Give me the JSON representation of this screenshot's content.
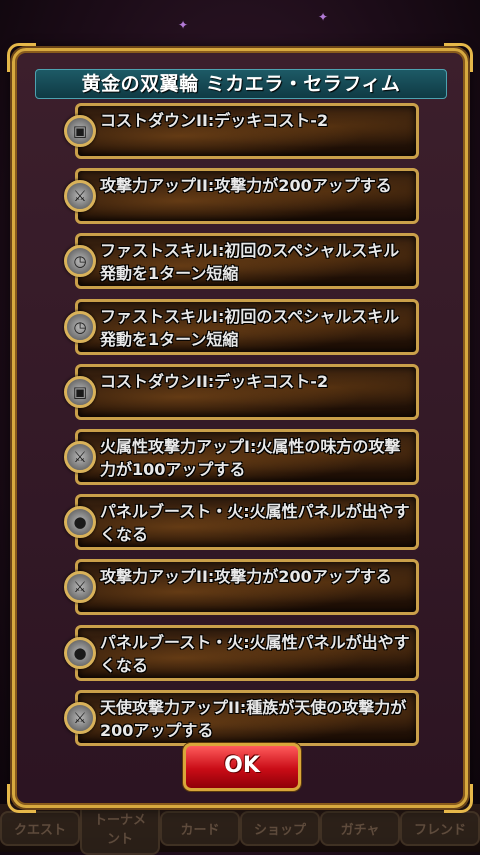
{
  "dialog": {
    "title": "黄金の双翼輪 ミカエラ・セラフィム",
    "skills": [
      {
        "text": "コストダウンII:デッキコスト-2",
        "icon": "card-icon"
      },
      {
        "text": "攻撃力アップII:攻撃力が200アップする",
        "icon": "sword-icon"
      },
      {
        "text": "ファストスキルI:初回のスペシャルスキル発動を1ターン短縮",
        "icon": "clock-icon"
      },
      {
        "text": "ファストスキルI:初回のスペシャルスキル発動を1ターン短縮",
        "icon": "clock-icon"
      },
      {
        "text": "コストダウンII:デッキコスト-2",
        "icon": "card-icon"
      },
      {
        "text": "火属性攻撃力アップI:火属性の味方の攻撃力が100アップする",
        "icon": "sword-icon"
      },
      {
        "text": "パネルブースト・火:火属性パネルが出やすくなる",
        "icon": "panel-icon"
      },
      {
        "text": "攻撃力アップII:攻撃力が200アップする",
        "icon": "sword-icon"
      },
      {
        "text": "パネルブースト・火:火属性パネルが出やすくなる",
        "icon": "panel-icon"
      },
      {
        "text": "天使攻撃力アップII:種族が天使の攻撃力が200アップする",
        "icon": "sword-icon"
      }
    ],
    "ok_label": "OK"
  },
  "background_tabs": [
    "クエスト",
    "トーナメント",
    "カード",
    "ショップ",
    "ガチャ",
    "フレンド"
  ],
  "colors": {
    "frame_gold": "#d7a93f",
    "title_teal": "#1d5a66",
    "ok_red": "#e0151f"
  }
}
